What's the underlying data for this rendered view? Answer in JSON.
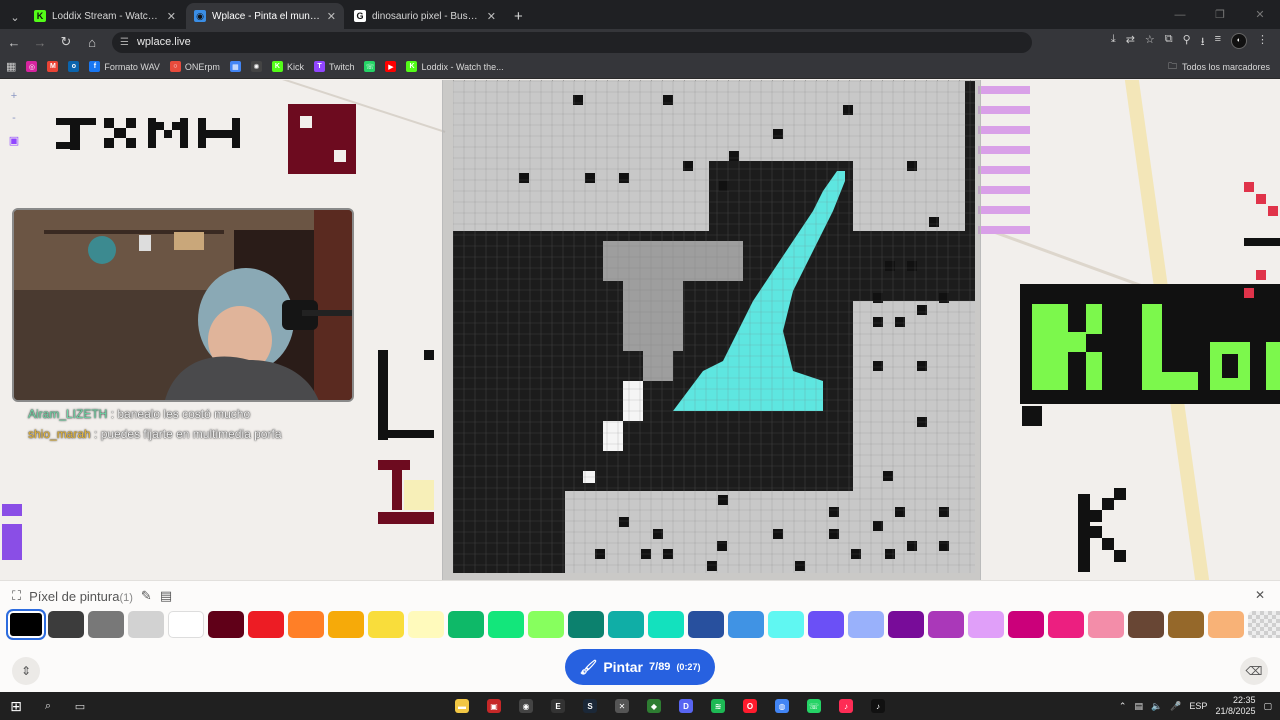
{
  "browser": {
    "tabs": [
      {
        "title": "Loddix Stream - Watch Live on",
        "favicon": "K",
        "fav_color": "#53fc18",
        "active": false
      },
      {
        "title": "Wplace - Pinta el mundo",
        "favicon": "◉",
        "fav_color": "#3a8ee6",
        "active": true
      },
      {
        "title": "dinosaurio pixel - Buscar con G",
        "favicon": "G",
        "fav_color": "#ffffff",
        "active": false
      }
    ],
    "new_tab": "+",
    "url": "wplace.live",
    "bookmarks": [
      {
        "label": "",
        "icon": "instagram-icon",
        "color": "#d6249f",
        "glyph": "◎"
      },
      {
        "label": "",
        "icon": "gmail-icon",
        "color": "#ea4335",
        "glyph": "M"
      },
      {
        "label": "",
        "icon": "outlook-icon",
        "color": "#0a64ad",
        "glyph": "o"
      },
      {
        "label": "Formato WAV",
        "icon": "facebook-icon",
        "color": "#1877f2",
        "glyph": "f"
      },
      {
        "label": "ONErpm",
        "icon": "onerpm-icon",
        "color": "#e84b3c",
        "glyph": "○"
      },
      {
        "label": "",
        "icon": "apps-icon",
        "color": "#4285f4",
        "glyph": "▦"
      },
      {
        "label": "",
        "icon": "chatgpt-icon",
        "color": "#444444",
        "glyph": "✺"
      },
      {
        "label": "Kick",
        "icon": "kick-icon",
        "color": "#53fc18",
        "glyph": "K"
      },
      {
        "label": "Twitch",
        "icon": "twitch-icon",
        "color": "#9146ff",
        "glyph": "T"
      },
      {
        "label": "",
        "icon": "whatsapp-icon",
        "color": "#25d366",
        "glyph": "☏"
      },
      {
        "label": "",
        "icon": "youtube-icon",
        "color": "#ff0000",
        "glyph": "▶"
      },
      {
        "label": "Loddix - Watch the...",
        "icon": "kick-icon",
        "color": "#53fc18",
        "glyph": "K"
      }
    ],
    "all_bookmarks": "Todos los marcadores"
  },
  "chat": [
    {
      "user": "Airam_LIZETH",
      "sep": " : ",
      "text": "banealo les costó mucho"
    },
    {
      "user": "shio_marah",
      "sep": " : ",
      "text": "puedes fijarte en multimedia porfa"
    }
  ],
  "palette": {
    "title": "Píxel de pintura",
    "count": "(1)",
    "colors": [
      "#000000",
      "#3c3c3c",
      "#787878",
      "#d2d2d2",
      "#ffffff",
      "#600018",
      "#ed1c24",
      "#ff7f27",
      "#f6aa09",
      "#f9dd3b",
      "#fffabc",
      "#0eb968",
      "#13e67b",
      "#87ff5e",
      "#0c816e",
      "#10aea6",
      "#13e1be",
      "#28509e",
      "#4093e4",
      "#60f7f2",
      "#6b50f6",
      "#99b1fb",
      "#780c99",
      "#aa38b9",
      "#e09ff9",
      "#cb007a",
      "#ec1f80",
      "#f38da9",
      "#684634",
      "#95682a",
      "#f8b277",
      "transparent"
    ],
    "selected_index": 0
  },
  "paint_button": {
    "label": "Pintar",
    "progress": "7/89",
    "timer": "(0:27)"
  },
  "taskbar": {
    "language": "ESP",
    "time": "22:35",
    "date": "21/8/2025",
    "apps": [
      {
        "icon": "file-explorer-icon",
        "color": "#f2c744",
        "glyph": "▬"
      },
      {
        "icon": "ticketing-app-icon",
        "color": "#c62828",
        "glyph": "▣"
      },
      {
        "icon": "obs-icon",
        "color": "#444444",
        "glyph": "◉"
      },
      {
        "icon": "epic-games-icon",
        "color": "#333333",
        "glyph": "E"
      },
      {
        "icon": "steam-icon",
        "color": "#1b2838",
        "glyph": "S"
      },
      {
        "icon": "pixel-app-icon",
        "color": "#555555",
        "glyph": "✕"
      },
      {
        "icon": "shield-icon",
        "color": "#2e7d32",
        "glyph": "◆"
      },
      {
        "icon": "discord-icon",
        "color": "#5865f2",
        "glyph": "D"
      },
      {
        "icon": "spotify-icon",
        "color": "#1db954",
        "glyph": "≋"
      },
      {
        "icon": "opera-icon",
        "color": "#ff1b2d",
        "glyph": "O"
      },
      {
        "icon": "chrome-icon",
        "color": "#4285f4",
        "glyph": "◍"
      },
      {
        "icon": "whatsapp-icon",
        "color": "#25d366",
        "glyph": "☏"
      },
      {
        "icon": "tiktok-live-icon",
        "color": "#fe2c55",
        "glyph": "♪"
      },
      {
        "icon": "tiktok-icon",
        "color": "#111111",
        "glyph": "♪"
      }
    ]
  }
}
